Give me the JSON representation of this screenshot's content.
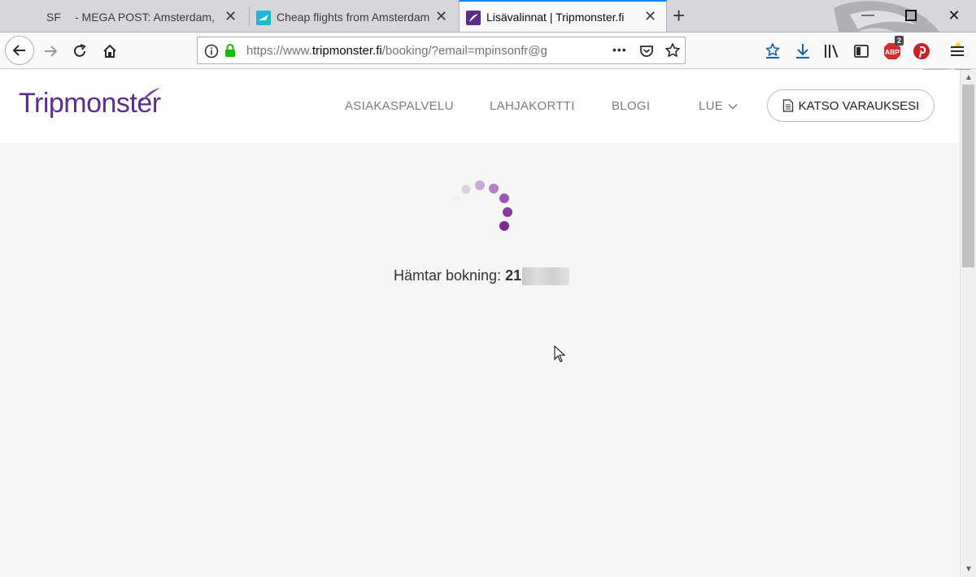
{
  "browser": {
    "tabs": [
      {
        "favicon": "SF",
        "title": "- MEGA POST: Amsterdam, Ne"
      },
      {
        "title": "Cheap flights from Amsterdam"
      },
      {
        "title": "Lisävalinnat | Tripmonster.fi"
      }
    ],
    "url_prefix": "https://www.",
    "url_domain": "tripmonster.fi",
    "url_rest": "/booking/?email=mpinsonfr@g",
    "url_more": "•••",
    "ext_badge_count": "2",
    "ext_abp_label": "ABP",
    "icons": [
      "back-arrow-icon",
      "forward-arrow-icon",
      "reload-icon",
      "home-icon",
      "info-icon",
      "lock-icon",
      "pocket-icon",
      "star-icon",
      "bookmarks-icon",
      "download-icon",
      "library-icon",
      "sidebar-icon",
      "adblock-icon",
      "pinterest-icon",
      "menu-icon"
    ]
  },
  "site": {
    "logo": "Tripmonster",
    "nav": {
      "customer_service": "ASIAKASPALVELU",
      "gift_card": "LAHJAKORTTI",
      "blog": "BLOGI",
      "read": "LUE",
      "bookings": "KATSO VARAUKSESI"
    },
    "accent_color": "#5c2d8c"
  },
  "loading": {
    "label": "Hämtar bokning:",
    "booking_number_visible": "21"
  }
}
